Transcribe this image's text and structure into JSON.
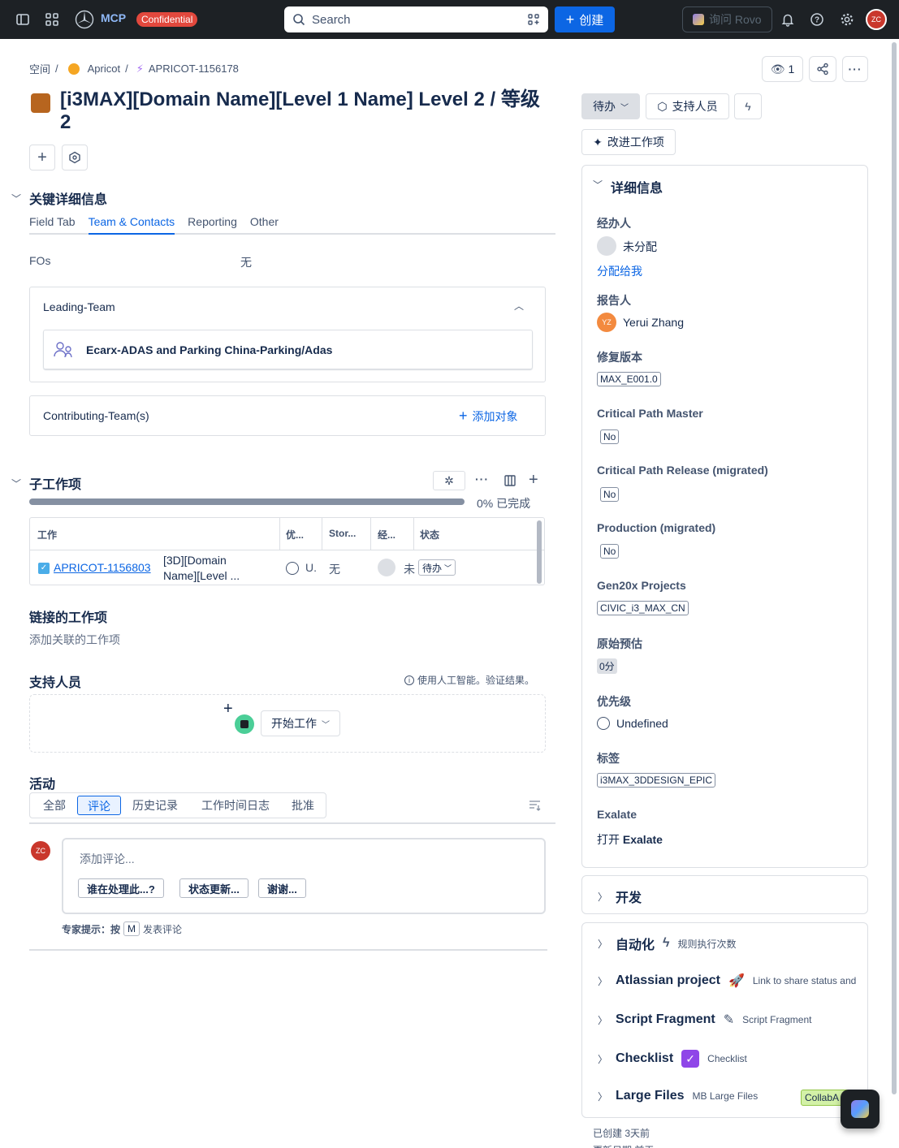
{
  "topbar": {
    "confidential": "Confidential",
    "search_placeholder": "Search",
    "create_label": "创建",
    "rovo_label": "询问 Rovo",
    "avatar_initials": "ZC"
  },
  "breadcrumb": {
    "space": "空间",
    "project": "Apricot",
    "issue_key": "APRICOT-1156178"
  },
  "header": {
    "watch_count": "1",
    "title": "[i3MAX][Domain Name][Level 1 Name] Level 2 / 等级 2"
  },
  "key_details": {
    "heading": "关键详细信息",
    "tabs": [
      "Field Tab",
      "Team & Contacts",
      "Reporting",
      "Other"
    ],
    "fos_label": "FOs",
    "fos_value": "无",
    "leading_team_label": "Leading-Team",
    "leading_team_value": "Ecarx-ADAS and Parking China-Parking/Adas",
    "contributing_label": "Contributing-Team(s)",
    "add_object_label": "添加对象"
  },
  "subtasks": {
    "heading": "子工作项",
    "progress_percent": 0,
    "progress_text": "0% 已完成",
    "columns": [
      "工作",
      "优...",
      "Stor...",
      "经...",
      "状态"
    ],
    "rows": [
      {
        "key": "APRICOT-1156803",
        "summary_line1": "[3D][Domain",
        "summary_line2": "Name][Level ...",
        "priority": "U.",
        "story": "无",
        "assignee": "未",
        "status": "待办"
      }
    ]
  },
  "linked": {
    "heading": "链接的工作项",
    "add_text": "添加关联的工作项"
  },
  "support": {
    "heading": "支持人员",
    "ai_note": "使用人工智能。验证结果。",
    "start_label": "开始工作"
  },
  "activity": {
    "heading": "活动",
    "tabs": [
      "全部",
      "评论",
      "历史记录",
      "工作时间日志",
      "批准"
    ],
    "comment_placeholder": "添加评论...",
    "chips": [
      "谁在处理此...?",
      "状态更新...",
      "谢谢..."
    ],
    "tip_prefix": "专家提示：按",
    "tip_key": "M",
    "tip_suffix": "发表评论"
  },
  "right": {
    "status_label": "待办",
    "support_label": "支持人员",
    "improve_label": "改进工作项",
    "details_heading": "详细信息",
    "assignee_label": "经办人",
    "assignee_value": "未分配",
    "assign_me": "分配给我",
    "reporter_label": "报告人",
    "reporter_initials": "YZ",
    "reporter_value": "Yerui Zhang",
    "fix_version_label": "修复版本",
    "fix_version_value": "MAX_E001.0",
    "cpm_label": "Critical Path Master",
    "cpm_value": "No",
    "cpr_label": "Critical Path Release (migrated)",
    "cpr_value": "No",
    "prod_label": "Production (migrated)",
    "prod_value": "No",
    "gen20x_label": "Gen20x Projects",
    "gen20x_value": "CIVIC_i3_MAX_CN",
    "estimate_label": "原始预估",
    "estimate_value": "0分",
    "priority_label": "优先级",
    "priority_value": "Undefined",
    "labels_label": "标签",
    "labels_value": "i3MAX_3DDESIGN_EPIC",
    "exalate_label": "Exalate",
    "exalate_open": "打开",
    "exalate_value": "Exalate",
    "dev_heading": "开发",
    "automation_heading": "自动化",
    "automation_sub": "规则执行次数",
    "atlassian_heading": "Atlassian project",
    "atlassian_sub": "Link to share status and",
    "script_heading": "Script Fragment",
    "script_sub": "Script Fragment",
    "checklist_heading": "Checklist",
    "checklist_sub": "Checklist",
    "largefiles_heading": "Large Files",
    "largefiles_sub": "MB Large Files",
    "collab_badge": "CollabA",
    "created": "已创建 3天前",
    "updated": "更新日期 前天"
  }
}
